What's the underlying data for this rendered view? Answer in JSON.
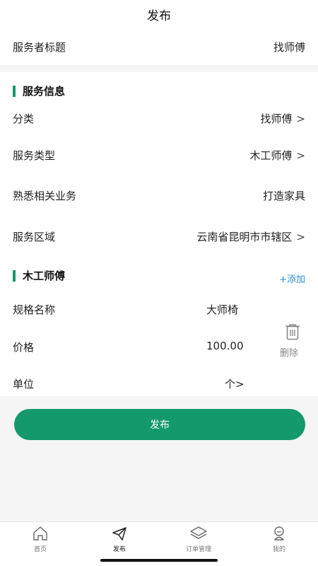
{
  "header": {
    "title": "发布"
  },
  "service_title": {
    "label": "服务者标题",
    "value": "找师傅"
  },
  "service_info": {
    "heading": "服务信息",
    "category": {
      "label": "分类",
      "value": "找师傅",
      "chevron": ">"
    },
    "service_type": {
      "label": "服务类型",
      "value": "木工师傅",
      "chevron": ">"
    },
    "familiar_business": {
      "label": "熟悉相关业务",
      "value": "打造家具"
    },
    "service_area": {
      "label": "服务区域",
      "value": "云南省昆明市市辖区",
      "chevron": ">"
    }
  },
  "spec_section": {
    "heading": "木工师傅",
    "add_label": "+添加",
    "spec_name": {
      "label": "规格名称",
      "value": "大师椅"
    },
    "price": {
      "label": "价格",
      "value": "100.00"
    },
    "unit": {
      "label": "单位",
      "value": "个",
      "chevron": ">"
    },
    "delete_label": "删除",
    "delete_icon": "trash-icon"
  },
  "publish_button": {
    "label": "发布"
  },
  "tabbar": {
    "tabs": [
      {
        "label": "首页",
        "icon": "home-icon"
      },
      {
        "label": "发布",
        "icon": "send-icon",
        "active": true
      },
      {
        "label": "订单管理",
        "icon": "layers-icon"
      },
      {
        "label": "我的",
        "icon": "user-icon"
      }
    ]
  },
  "colors": {
    "accent": "#14996c",
    "link": "#2b8fd6",
    "background": "#f5f5f5"
  }
}
